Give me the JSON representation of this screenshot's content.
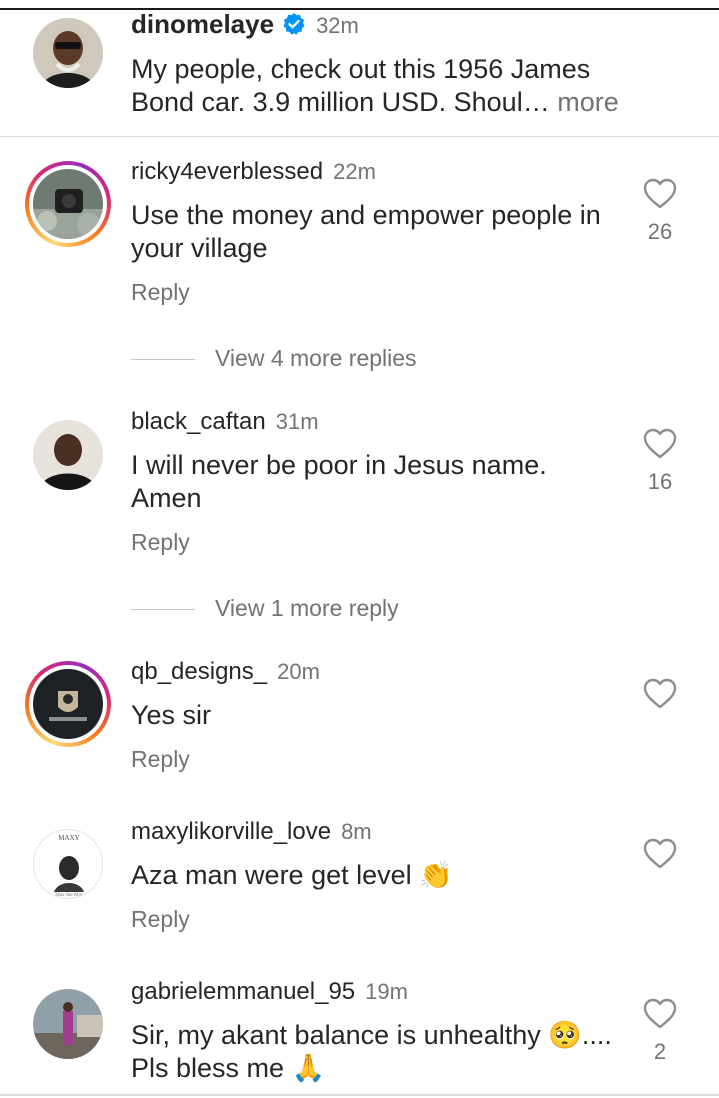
{
  "caption": {
    "username": "dinomelaye",
    "time": "32m",
    "text_line1": "My people, check out this 1956 James",
    "text_line2": "Bond car. 3.9 million USD. Shoul…",
    "more_label": "more",
    "verified_icon": "verified-badge-icon"
  },
  "comments": [
    {
      "username": "ricky4everblessed",
      "time": "22m",
      "text_line1": "Use the money and empower people in",
      "text_line2": "your village",
      "reply_label": "Reply",
      "likes": "26",
      "view_more": "View 4 more replies"
    },
    {
      "username": "black_caftan",
      "time": "31m",
      "text_line1": "I will never be poor in Jesus name.",
      "text_line2": "Amen",
      "reply_label": "Reply",
      "likes": "16",
      "view_more": "View 1 more reply"
    },
    {
      "username": "qb_designs_",
      "time": "20m",
      "text_line1": "Yes sir",
      "reply_label": "Reply",
      "likes": ""
    },
    {
      "username": "maxylikorville_love",
      "time": "8m",
      "text_line1": "Aza man were get level 👏",
      "reply_label": "Reply",
      "likes": "",
      "avatar_text_top": "MAXY",
      "avatar_text_bottom": "Max-Ike-Mor"
    },
    {
      "username": "gabrielemmanuel_95",
      "time": "19m",
      "text_line1": "Sir, my akant balance is unhealthy 🥺....",
      "text_line2": "Pls bless me 🙏",
      "likes": "2"
    }
  ],
  "colors": {
    "text": "#262626",
    "secondary": "#737373",
    "verified": "#0095f6",
    "story_ring": [
      "#feda75",
      "#fa7e1e",
      "#d62976",
      "#962fbf"
    ]
  }
}
